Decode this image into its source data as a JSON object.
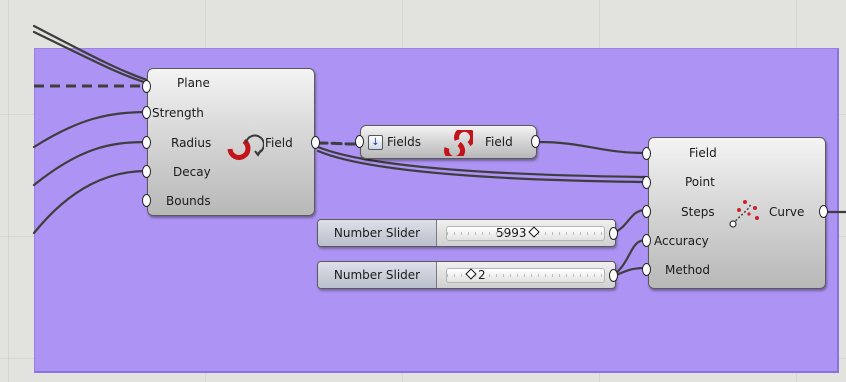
{
  "canvas": {
    "group_color": "#ad93f3",
    "wire_color": "#3e3e3e"
  },
  "field_component": {
    "inputs": [
      "Plane",
      "Strength",
      "Radius",
      "Decay",
      "Bounds"
    ],
    "output": "Field",
    "icon": "spin-field-icon"
  },
  "merge_component": {
    "input": "Fields",
    "output": "Field",
    "icon": "merge-fields-icon"
  },
  "line_component": {
    "inputs": [
      "Field",
      "Point",
      "Steps",
      "Accuracy",
      "Method"
    ],
    "output": "Curve",
    "icon": "field-line-icon"
  },
  "sliders": [
    {
      "label": "Number Slider",
      "value": "5993",
      "fraction": 0.52
    },
    {
      "label": "Number Slider",
      "value": "2",
      "fraction": 0.22
    }
  ]
}
